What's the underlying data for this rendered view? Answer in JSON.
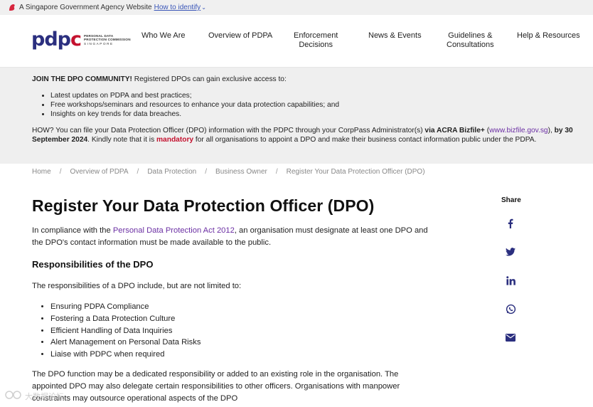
{
  "gov_banner": {
    "text": "A Singapore Government Agency Website",
    "link": "How to identify"
  },
  "logo": {
    "mark_left": "pdp",
    "mark_right": "c",
    "line1": "PERSONAL DATA",
    "line2": "PROTECTION COMMISSION",
    "line3": "SINGAPORE"
  },
  "nav": {
    "items": [
      {
        "line1": "Who We Are",
        "line2": ""
      },
      {
        "line1": "Overview of PDPA",
        "line2": ""
      },
      {
        "line1": "Enforcement",
        "line2": "Decisions"
      },
      {
        "line1": "News & Events",
        "line2": ""
      },
      {
        "line1": "Guidelines &",
        "line2": "Consultations"
      },
      {
        "line1": "Help & Resources",
        "line2": ""
      }
    ]
  },
  "community": {
    "title_bold": "JOIN THE DPO COMMUNITY!",
    "title_rest": " Registered DPOs can gain exclusive access to:",
    "bullets": [
      "Latest updates on PDPA and best practices;",
      "Free workshops/seminars and resources to enhance your data protection capabilities; and",
      "Insights on key trends for data breaches."
    ],
    "how_1": "HOW?  You can file your Data Protection Officer (DPO) information with the PDPC through your CorpPass Administrator(s) ",
    "how_bold_1": "via ACRA Bizfile+",
    "how_2": " (",
    "how_link": "www.bizfile.gov.sg",
    "how_3": "), ",
    "how_bold_2": "by 30 September 2024",
    "how_4": ". Kindly note that it is ",
    "how_mandatory": "mandatory",
    "how_5": " for all organisations to appoint a DPO and make their business contact information public under the PDPA."
  },
  "breadcrumb": {
    "items": [
      "Home",
      "Overview of PDPA",
      "Data Protection",
      "Business Owner",
      "Register Your Data Protection Officer (DPO)"
    ],
    "separator": "/"
  },
  "main": {
    "title": "Register Your Data Protection Officer (DPO)",
    "intro_1": "In compliance with the ",
    "intro_link": "Personal Data Protection Act 2012",
    "intro_2": ", an organisation must designate at least one DPO and the DPO's contact information must be made available to the public.",
    "responsibilities_heading": "Responsibilities of the DPO",
    "responsibilities_intro": "The responsibilities of a DPO include, but are not limited to:",
    "responsibilities": [
      "Ensuring PDPA Compliance",
      "Fostering a Data Protection Culture",
      "Efficient Handling of Data Inquiries",
      "Alert Management on Personal Data Risks",
      "Liaise with PDPC when required"
    ],
    "paragraph": "The DPO function may be a dedicated responsibility or added to an existing role in the organisation. The appointed DPO may also delegate certain responsibilities to other officers. Organisations with manpower constraints may outsource operational aspects of the DPO"
  },
  "share": {
    "label": "Share",
    "icons": [
      "facebook-icon",
      "twitter-icon",
      "linkedin-icon",
      "whatsapp-icon",
      "email-icon"
    ]
  },
  "watermark": {
    "text": "大数据论坛"
  },
  "colors": {
    "brand_navy": "#2b2f7f",
    "brand_red": "#c4122f",
    "link_purple": "#6b2fa3",
    "icon_navy": "#2b2f7f",
    "banner_bg": "#efefef"
  }
}
